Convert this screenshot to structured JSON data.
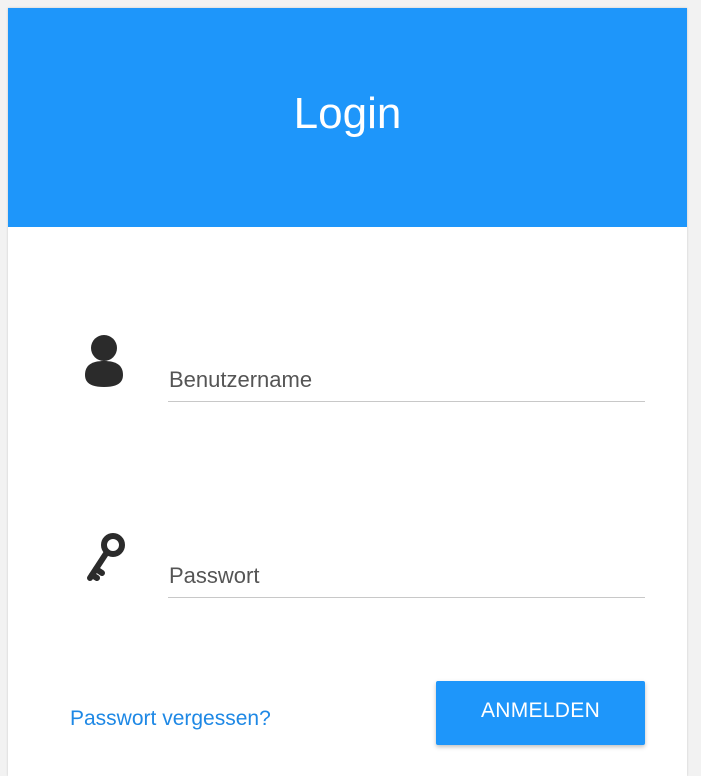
{
  "header": {
    "title": "Login",
    "color": "#1e96fa"
  },
  "form": {
    "username": {
      "icon": "user-icon",
      "value": "",
      "placeholder": "Benutzername"
    },
    "password": {
      "icon": "key-icon",
      "value": "",
      "placeholder": "Passwort"
    }
  },
  "footer": {
    "forgot_label": "Passwort vergessen?",
    "submit_label": "ANMELDEN",
    "link_color": "#1e88e5"
  }
}
